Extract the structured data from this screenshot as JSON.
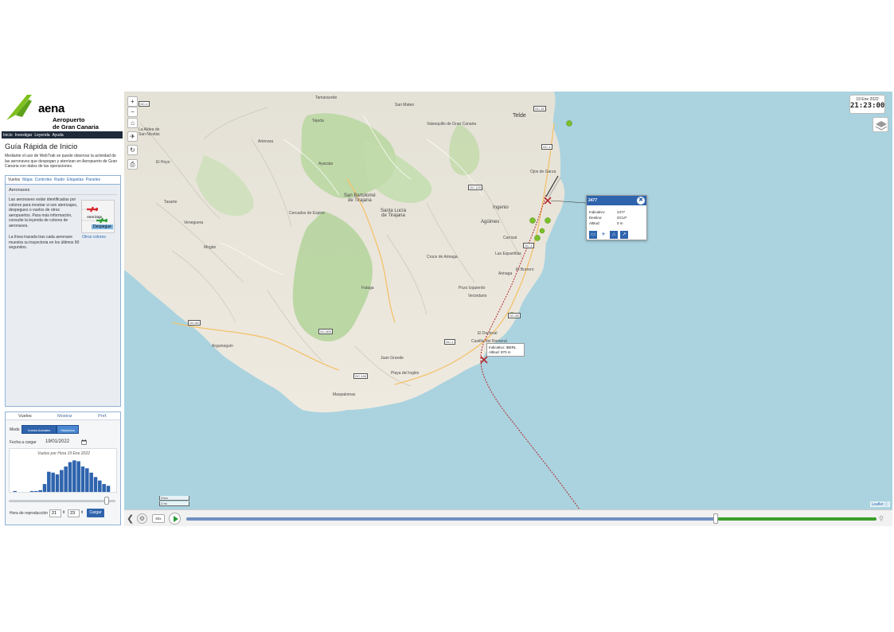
{
  "header": {
    "brand": "aena",
    "airport": "Aeropuerto\nde Gran Canaria",
    "nav": [
      "Inicio",
      "Investigar",
      "Leyenda",
      "Ayuda"
    ]
  },
  "guide": {
    "title": "Guía Rápida de Inicio",
    "text": "Mediante el uso de WebTrak se puede observar la actividad de las aeronaves que despegan y aterrizan en Aeropuerto de Gran Canaria con datos de las operaciones."
  },
  "tabs": [
    "Vuelos",
    "Mapa",
    "Controles",
    "Ruido",
    "Etiquetas",
    "Paneles"
  ],
  "aeronaves": {
    "title": "Aeronaves",
    "text1": "Las aeronaves están identificadas por colores para mostrar si son aterrizajes, despegues o vuelos de otros aeropuertos. Para más información, consulte la leyenda de colores de aeronaves.",
    "text2": "La línea trazada tras cada aeronave muestra su trayectoria en los últimos 90 segundos.",
    "otros_link": "Otros colores",
    "legend_land": "Aterrizaje",
    "legend_dep": "Despegue"
  },
  "flight_panel": {
    "tabs": [
      "Vuelos",
      "Mostrar",
      "Pref."
    ],
    "modo_label": "Modo",
    "modo_options": [
      "Vuelos Actuales",
      "Históricos"
    ],
    "fecha_label": "Fecha a cargar",
    "fecha_value": "19/01/2022",
    "hora_label": "Hora de reproducción",
    "hora_h": "21",
    "hora_m": "23",
    "cargar": "Cargar"
  },
  "chart_data": {
    "type": "bar",
    "title": "Vuelos por Hora 19 Ene 2022",
    "categories": [
      "0",
      "1",
      "2",
      "3",
      "4",
      "5",
      "6",
      "7",
      "8",
      "9",
      "10",
      "11",
      "12",
      "13",
      "14",
      "15",
      "16",
      "17",
      "18",
      "19",
      "20",
      "21",
      "22",
      "23"
    ],
    "values": [
      1,
      0,
      0,
      0,
      1,
      1,
      2,
      9,
      23,
      22,
      20,
      25,
      29,
      34,
      36,
      35,
      29,
      27,
      22,
      17,
      13,
      9,
      7,
      0
    ],
    "ylim": [
      0,
      40
    ],
    "bar_color": "#2f64ad",
    "grid": false
  },
  "map": {
    "clock_date": "19 Ene 2022",
    "clock_time": "21:23:00",
    "places": [
      {
        "t": "Telde",
        "c": "big"
      },
      {
        "t": "Ingenio",
        "c": "mid"
      },
      {
        "t": "Agüimes",
        "c": "mid"
      },
      {
        "t": "San Bartolomé\nde Tirajana",
        "c": "mid"
      },
      {
        "t": "Santa Lucía\nde Tirajana",
        "c": "mid"
      },
      {
        "t": "Valsequillo de Gran Canaria",
        "c": ""
      },
      {
        "t": "San Mateo",
        "c": ""
      },
      {
        "t": "Tejeda",
        "c": ""
      },
      {
        "t": "Artenara",
        "c": ""
      },
      {
        "t": "Mogán",
        "c": ""
      },
      {
        "t": "La Aldea de\nSan Nicolás",
        "c": ""
      },
      {
        "t": "Arinaga",
        "c": ""
      },
      {
        "t": "Juan Grande",
        "c": ""
      },
      {
        "t": "Playa del Inglés",
        "c": ""
      },
      {
        "t": "Maspalomas",
        "c": ""
      },
      {
        "t": "Arguineguín",
        "c": ""
      },
      {
        "t": "El Doctoral",
        "c": ""
      },
      {
        "t": "Vecindario",
        "c": ""
      },
      {
        "t": "Cruce de Arinaga",
        "c": ""
      },
      {
        "t": "Carrizal",
        "c": ""
      },
      {
        "t": "Las Esparrillas",
        "c": ""
      },
      {
        "t": "El Burrero",
        "c": ""
      },
      {
        "t": "Ojos de Garza",
        "c": ""
      },
      {
        "t": "Pozo Izquierdo",
        "c": ""
      },
      {
        "t": "Castillo del Romeral",
        "c": ""
      },
      {
        "t": "Fataga",
        "c": ""
      },
      {
        "t": "Ayacata",
        "c": ""
      },
      {
        "t": "Cercados de Espino",
        "c": ""
      },
      {
        "t": "Veneguera",
        "c": ""
      },
      {
        "t": "Tasarte",
        "c": ""
      },
      {
        "t": "El Hoyo",
        "c": ""
      },
      {
        "t": "Tamaraceite",
        "c": ""
      }
    ],
    "roads": [
      "GC-1",
      "GC-1",
      "GC-1",
      "GC-1",
      "GC-65",
      "GC-500",
      "GC-60",
      "GC-120",
      "GC-140",
      "GC-41"
    ],
    "popup": {
      "title": "2477",
      "rows": [
        {
          "label": "Indicativo:",
          "value": "2477"
        },
        {
          "label": "Destino:",
          "value": "GCLP"
        },
        {
          "label": "Altitud:",
          "value": "0 m"
        }
      ]
    },
    "tooltip": {
      "line1": "Indicativo: IBERL",
      "line2": "Altitud: 870 m"
    },
    "scale": [
      "3 km",
      "2 mi"
    ],
    "attribution": "Leaflet"
  },
  "playbar": {
    "speed": "60x",
    "progress": 0.75
  },
  "colors": {
    "accent": "#2f64ad",
    "sea": "#aad3df",
    "track": "#b3272d",
    "arrival": "#7bbf2a"
  }
}
